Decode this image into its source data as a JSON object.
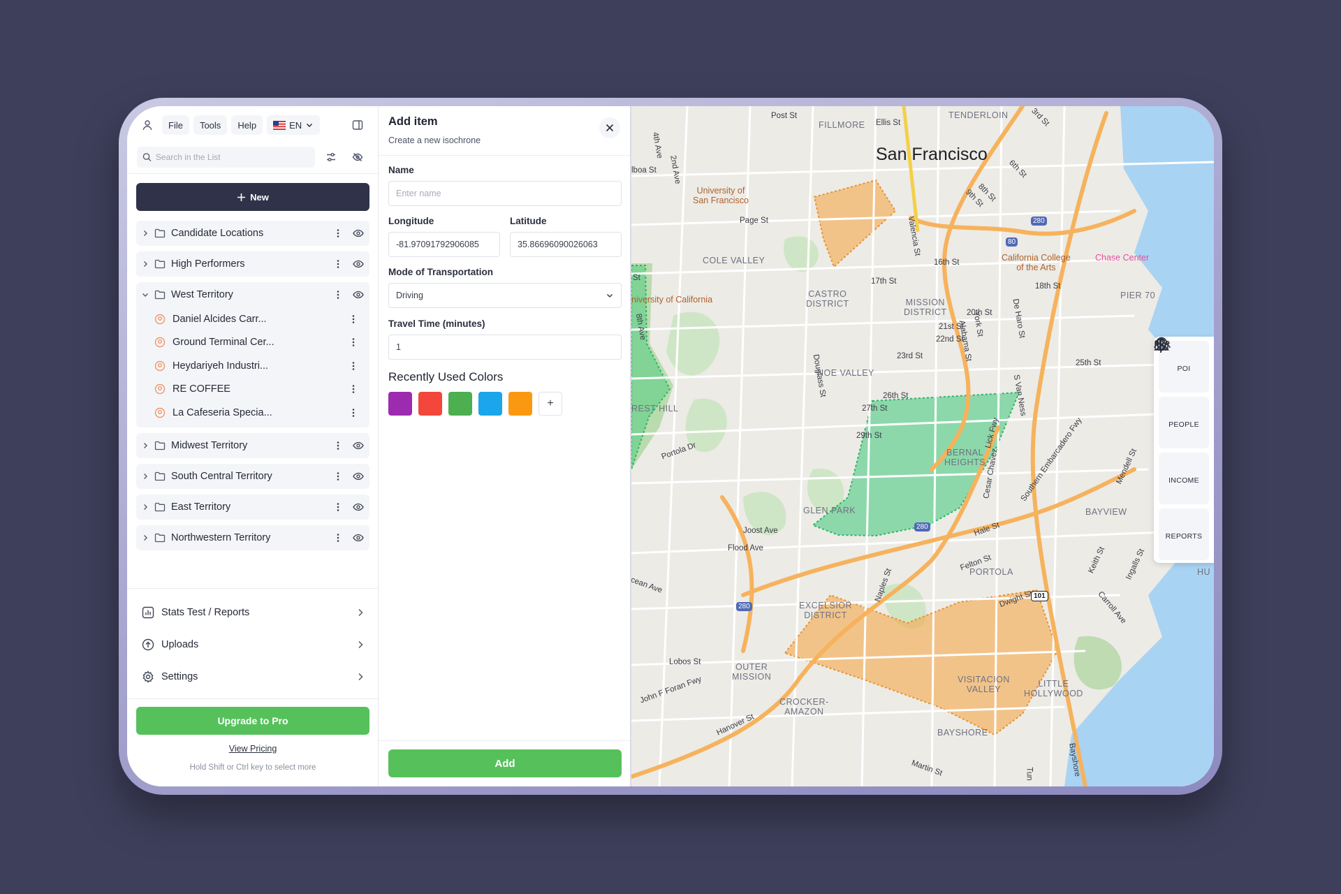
{
  "topbar": {
    "menu": [
      "File",
      "Tools",
      "Help"
    ],
    "language": "EN"
  },
  "search": {
    "placeholder": "Search in the List"
  },
  "new_button": "New",
  "folders": [
    {
      "name": "Candidate Locations",
      "expanded": false
    },
    {
      "name": "High Performers",
      "expanded": false
    },
    {
      "name": "West Territory",
      "expanded": true,
      "children": [
        "Daniel Alcides Carr...",
        "Ground Terminal Cer...",
        "Heydariyeh Industri...",
        "RE COFFEE",
        "La Cafeseria Specia..."
      ]
    },
    {
      "name": "Midwest Territory",
      "expanded": false
    },
    {
      "name": "South Central Territory",
      "expanded": false
    },
    {
      "name": "East Territory",
      "expanded": false
    },
    {
      "name": "Northwestern Territory",
      "expanded": false
    }
  ],
  "bottom_nav": [
    {
      "label": "Stats Test / Reports",
      "icon": "chart-icon"
    },
    {
      "label": "Uploads",
      "icon": "upload-icon"
    },
    {
      "label": "Settings",
      "icon": "gear-icon"
    }
  ],
  "upgrade_button": "Upgrade to Pro",
  "view_pricing": "View Pricing",
  "hint": "Hold Shift or Ctrl key to select more",
  "form": {
    "title": "Add item",
    "subtitle": "Create a new isochrone",
    "name_label": "Name",
    "name_placeholder": "Enter name",
    "longitude_label": "Longitude",
    "longitude_value": "-81.97091792906085",
    "latitude_label": "Latitude",
    "latitude_value": "35.86696090026063",
    "mode_label": "Mode of Transportation",
    "mode_value": "Driving",
    "travel_label": "Travel Time (minutes)",
    "travel_value": "1",
    "colors_title": "Recently Used Colors",
    "colors": [
      "#9c2bb0",
      "#f2473a",
      "#4caf50",
      "#1ba5ea",
      "#fb9812"
    ],
    "add_color": "+",
    "add_button": "Add"
  },
  "map": {
    "city": "San Francisco",
    "districts": [
      {
        "text": "FILLMORE"
      },
      {
        "text": "TENDERLOIN"
      },
      {
        "text": "COLE VALLEY"
      },
      {
        "text": "CASTRO\nDISTRICT"
      },
      {
        "text": "MISSION\nDISTRICT"
      },
      {
        "text": "NOE VALLEY"
      },
      {
        "text": "BERNAL\nHEIGHTS"
      },
      {
        "text": "GLEN PARK"
      },
      {
        "text": "PORTOLA"
      },
      {
        "text": "BAYVIEW"
      },
      {
        "text": "EXCELSIOR\nDISTRICT"
      },
      {
        "text": "OUTER\nMISSION"
      },
      {
        "text": "CROCKER-\nAMAZON"
      },
      {
        "text": "VISITACION\nVALLEY"
      },
      {
        "text": "LITTLE\nHOLLYWOOD"
      },
      {
        "text": "BAYSHORE"
      },
      {
        "text": "PIER 70"
      }
    ],
    "pois": [
      {
        "text": "University of\nSan Francisco"
      },
      {
        "text": "niversity of California"
      },
      {
        "text": "California College\nof the Arts"
      },
      {
        "text": "Chase Center"
      }
    ],
    "streets": [
      "Post St",
      "Ellis St",
      "3rd St",
      "4th Ave",
      "2nd Ave",
      "lboa St",
      "6th St",
      "8th St",
      "9th St",
      "Page St",
      "16th St",
      "17th St",
      "18th St",
      "20th St",
      "21st St",
      "22nd St",
      "23rd St",
      "25th St",
      "26th St",
      "27th St",
      "29th St",
      "Valencia St",
      "York St",
      "Alabama St",
      "Douglass St",
      "De Haro St",
      "8th Ave",
      "Portola Dr",
      "Joost Ave",
      "Flood Ave",
      "Hale St",
      "Felton St",
      "Dwight St",
      "Lobos St",
      "John F Foran Fwy",
      "Hanover St",
      "Martin St",
      "Naples St",
      "Southern Embarcadero Fwy",
      "S Van Ness",
      "Mendell St",
      "Keith St",
      "Ingalls St",
      "Carroll Ave",
      "cean Ave",
      "REST HILL",
      "Bayshore",
      "Tun",
      "St",
      "HU",
      "Cesar Chavez",
      "Lick Fwy"
    ],
    "tools": [
      {
        "label": "POI",
        "icon": "map-pin-icon"
      },
      {
        "label": "PEOPLE",
        "icon": "people-icon"
      },
      {
        "label": "INCOME",
        "icon": "dollar-icon"
      },
      {
        "label": "REPORTS",
        "icon": "bar-chart-icon"
      }
    ],
    "shield_numbers": [
      "280",
      "80",
      "280",
      "280",
      "101"
    ]
  }
}
